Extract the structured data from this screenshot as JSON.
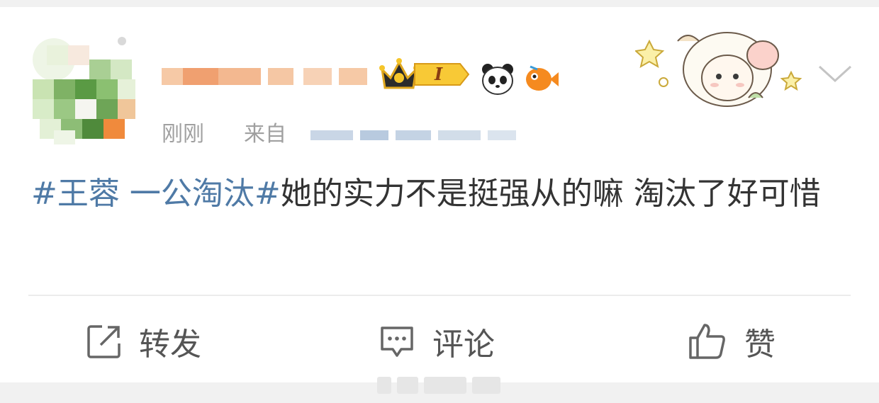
{
  "post": {
    "time": "刚刚",
    "source_prefix": "来自",
    "hashtag": "#王蓉 一公淘汰#",
    "body_text": "她的实力不是挺强从的嘛 淘汰了好可惜",
    "level_badge": "I"
  },
  "icons": {
    "crown": "crown-badge-icon",
    "panda": "panda-badge-icon",
    "fish": "fish-badge-icon",
    "chevron": "chevron-down-icon",
    "repost": "repost-icon",
    "comment": "comment-icon",
    "like": "thumbs-up-icon"
  },
  "actions": {
    "repost_label": "转发",
    "comment_label": "评论",
    "like_label": "赞"
  },
  "colors": {
    "hashtag": "#4f7aa6",
    "text": "#333333",
    "meta": "#a0a0a0"
  }
}
